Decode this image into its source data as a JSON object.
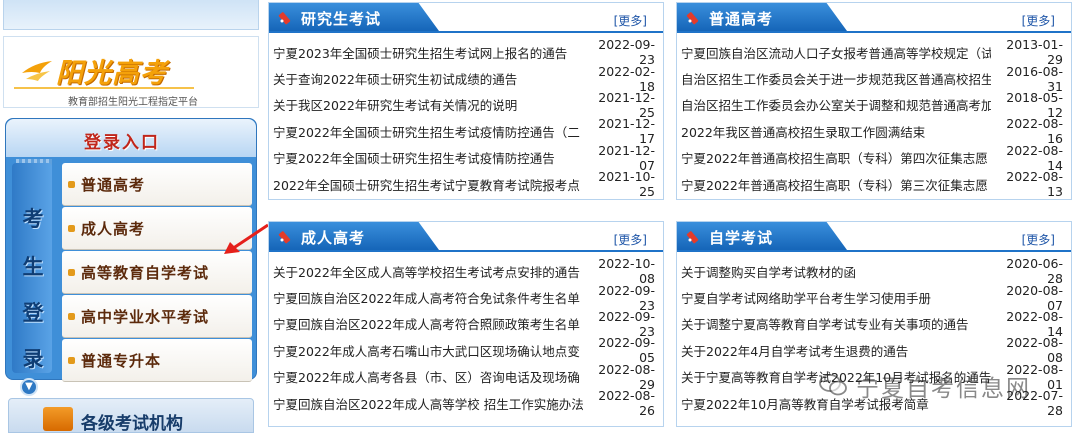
{
  "left": {
    "banner_title": "阳光高考",
    "banner_subtitle": "教育部招生阳光工程指定平台",
    "login_title": "登录入口",
    "login_side": [
      "考",
      "生",
      "登",
      "录"
    ],
    "login_items": [
      {
        "label": "普通高考"
      },
      {
        "label": "成人高考"
      },
      {
        "label": "高等教育自学考试"
      },
      {
        "label": "高中学业水平考试"
      },
      {
        "label": "普通专升本"
      }
    ],
    "org_title": "各级考试机构"
  },
  "panels": [
    {
      "title": "研究生考试",
      "more": "[更多]",
      "items": [
        {
          "title": "宁夏2023年全国硕士研究生招生考试网上报名的通告",
          "date": "2022-09-23"
        },
        {
          "title": "关于查询2022年硕士研究生初试成绩的通告",
          "date": "2022-02-18"
        },
        {
          "title": "关于我区2022年研究生考试有关情况的说明",
          "date": "2021-12-25"
        },
        {
          "title": "宁夏2022年全国硕士研究生招生考试疫情防控通告（二",
          "date": "2021-12-17"
        },
        {
          "title": "宁夏2022年全国硕士研究生招生考试疫情防控通告",
          "date": "2021-12-07"
        },
        {
          "title": "2022年全国硕士研究生招生考试宁夏教育考试院报考点",
          "date": "2021-10-25"
        }
      ]
    },
    {
      "title": "普通高考",
      "more": "[更多]",
      "items": [
        {
          "title": "宁夏回族自治区流动人口子女报考普通高等学校规定（试",
          "date": "2013-01-29"
        },
        {
          "title": "自治区招生工作委员会关于进一步规范我区普通高校招生",
          "date": "2016-08-31"
        },
        {
          "title": "自治区招生工作委员会办公室关于调整和规范普通高考加",
          "date": "2018-05-12"
        },
        {
          "title": "2022年我区普通高校招生录取工作圆满结束",
          "date": "2022-08-16"
        },
        {
          "title": "宁夏2022年普通高校招生高职（专科）第四次征集志愿",
          "date": "2022-08-14"
        },
        {
          "title": "宁夏2022年普通高校招生高职（专科）第三次征集志愿",
          "date": "2022-08-13"
        }
      ]
    },
    {
      "title": "成人高考",
      "more": "[更多]",
      "items": [
        {
          "title": "关于2022年全区成人高等学校招生考试考点安排的通告",
          "date": "2022-10-08"
        },
        {
          "title": "宁夏回族自治区2022年成人高考符合免试条件考生名单",
          "date": "2022-09-23"
        },
        {
          "title": "宁夏回族自治区2022年成人高考符合照顾政策考生名单",
          "date": "2022-09-23"
        },
        {
          "title": "宁夏2022年成人高考石嘴山市大武口区现场确认地点变",
          "date": "2022-09-05"
        },
        {
          "title": "宁夏2022年成人高考各县（市、区）咨询电话及现场确",
          "date": "2022-08-29"
        },
        {
          "title": "宁夏回族自治区2022年成人高等学校 招生工作实施办法",
          "date": "2022-08-26"
        }
      ]
    },
    {
      "title": "自学考试",
      "more": "[更多]",
      "items": [
        {
          "title": "关于调整购买自学考试教材的函",
          "date": "2020-06-28"
        },
        {
          "title": "宁夏自学考试网络助学平台考生学习使用手册",
          "date": "2020-08-07"
        },
        {
          "title": "关于调整宁夏高等教育自学考试专业有关事项的通告",
          "date": "2022-08-14"
        },
        {
          "title": "关于2022年4月自学考试考生退费的通告",
          "date": "2022-08-08"
        },
        {
          "title": "关于宁夏高等教育自学考试2022年10月考试报名的通告",
          "date": "2022-08-01"
        },
        {
          "title": "宁夏2022年10月高等教育自学考试报考简章",
          "date": "2022-07-28"
        }
      ]
    }
  ],
  "watermark": "宁夏自考信息网",
  "colors": {
    "tab_blue": "#1f73c8",
    "login_text": "#5c2a0c",
    "login_title": "#c0261b",
    "banner_orange": "#f4a10a",
    "arrow_red": "#e5201b"
  }
}
